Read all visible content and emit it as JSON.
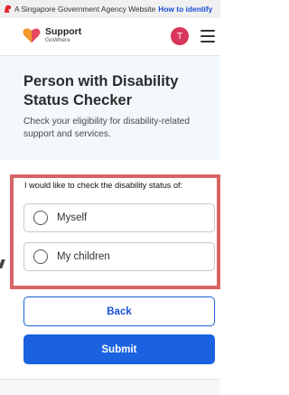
{
  "gov_banner": {
    "text": "A Singapore Government Agency Website",
    "link": "How to identify"
  },
  "header": {
    "brand_name": "Support",
    "brand_sub": "GoWhere",
    "avatar_initial": "T"
  },
  "hero": {
    "title": "Person with Disability Status Checker",
    "description": "Check your eligibility for disability-related support and services."
  },
  "form": {
    "question": "I would like to check the disability status of:",
    "options": [
      {
        "label": "Myself",
        "selected": false
      },
      {
        "label": "My children",
        "selected": false
      }
    ]
  },
  "buttons": {
    "back": "Back",
    "submit": "Submit"
  },
  "colors": {
    "primary": "#1a62e0",
    "highlight": "#d86466",
    "avatar": "#d9365b",
    "hero_bg": "#f3f8fd"
  }
}
